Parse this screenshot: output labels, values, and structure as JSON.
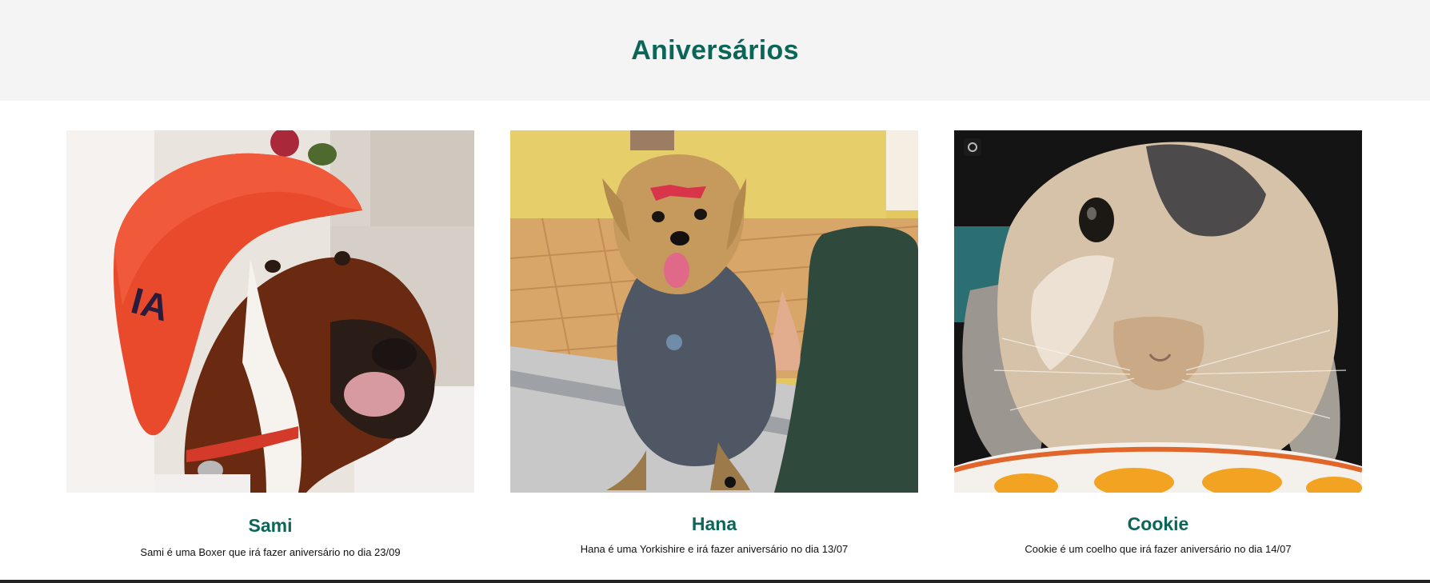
{
  "section": {
    "title": "Aniversários"
  },
  "cards": [
    {
      "name": "Sami",
      "description": "Sami é uma Boxer que irá fazer aniversário no dia 23/09",
      "image_alt": "boxer dog wearing a red cap"
    },
    {
      "name": "Hana",
      "description": "Hana é uma Yorkishire e irá fazer aniversário no dia 13/07",
      "image_alt": "yorkshire terrier with a bow on a window ledge"
    },
    {
      "name": "Cookie",
      "description": "Cookie é um coelho que irá fazer aniversário no dia 14/07",
      "image_alt": "lop-eared rabbit close-up over an orange bowl"
    }
  ],
  "colors": {
    "accent": "#0b6658",
    "header_bg": "#f4f4f4"
  }
}
